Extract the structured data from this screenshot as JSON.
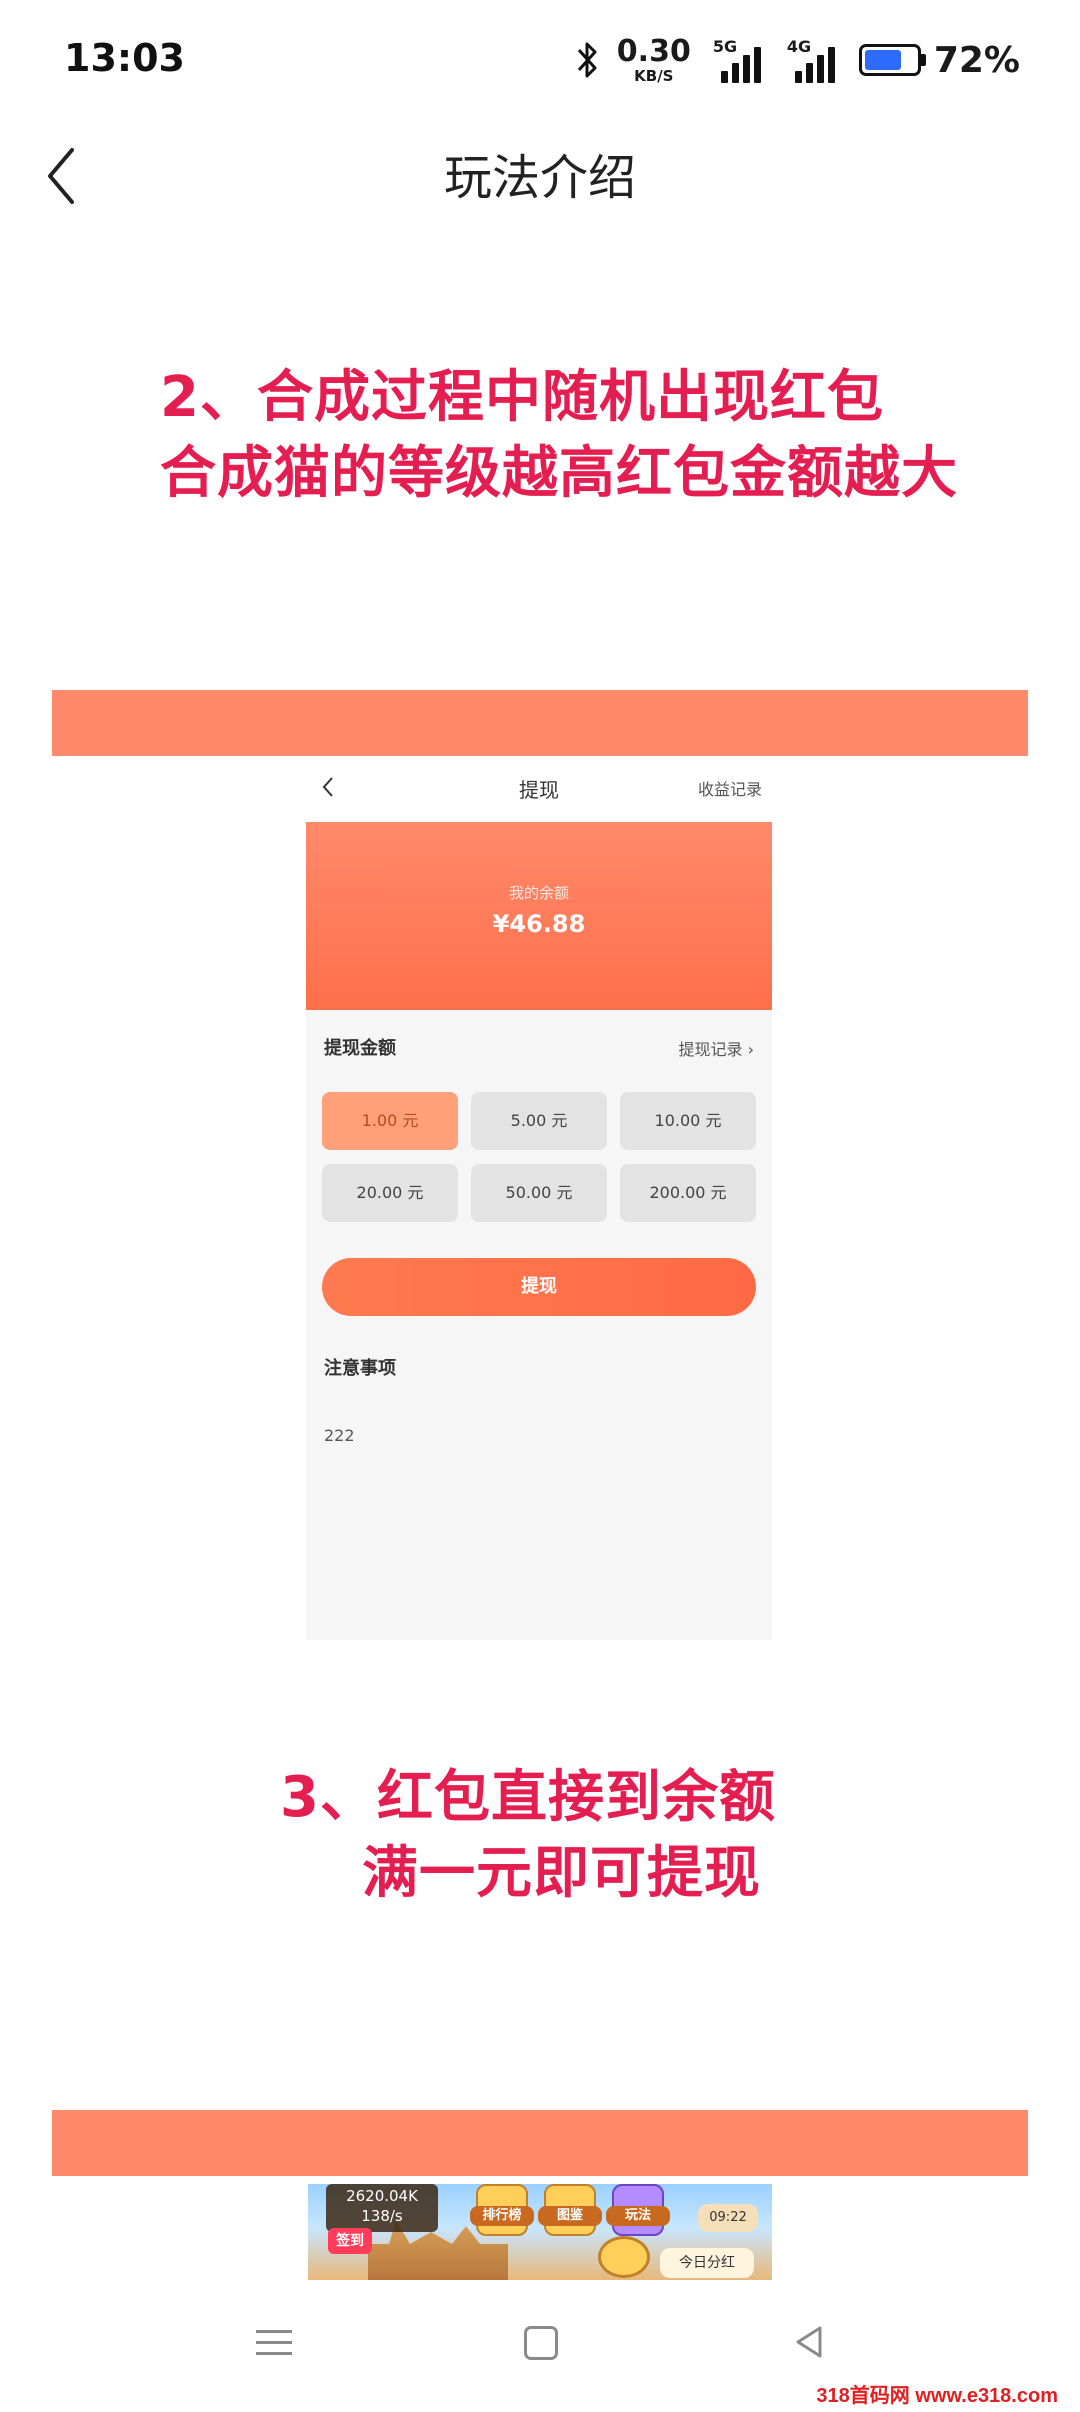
{
  "status_bar": {
    "time": "13:03",
    "net_speed_value": "0.30",
    "net_speed_unit": "KB/S",
    "signal_1_label": "5G",
    "signal_2_label": "4G",
    "battery_percent": "72%",
    "battery_level": 0.72,
    "battery_color": "#2e6bff",
    "icons": [
      "bluetooth-icon",
      "signal-icon",
      "battery-charging-icon"
    ]
  },
  "header": {
    "back_icon": "chevron-left-icon",
    "title": "玩法介绍"
  },
  "step2": {
    "line1": "2、合成过程中随机出现红包",
    "line2": "合成猫的等级越高红包金额越大"
  },
  "withdraw_screen": {
    "title": "提现",
    "earnings_record": "收益记录",
    "balance_label": "我的余额",
    "balance_value": "¥46.88",
    "amount_title": "提现金额",
    "withdraw_record": "提现记录",
    "options": [
      "1.00 元",
      "5.00 元",
      "10.00 元",
      "20.00 元",
      "50.00 元",
      "200.00 元"
    ],
    "selected_option": "1.00 元",
    "submit_label": "提现",
    "notes_title": "注意事项",
    "notes_body": "222",
    "accent_color": "#ff7a50"
  },
  "step3": {
    "line1": "3、红包直接到余额",
    "line2": "满一元即可提现"
  },
  "game_preview": {
    "score_value": "2620.04K",
    "score_rate": "138/s",
    "btn_rank": "排行榜",
    "btn_book": "图鉴",
    "btn_play": "玩法",
    "timer": "09:22",
    "signin": "签到",
    "today": "今日分红"
  },
  "nav": {
    "icons": [
      "menu-icon",
      "home-icon",
      "back-triangle-icon"
    ]
  },
  "watermark": "318首码网 www.e318.com",
  "colors": {
    "headline": "#e51e51",
    "band": "#ff8a6b"
  }
}
